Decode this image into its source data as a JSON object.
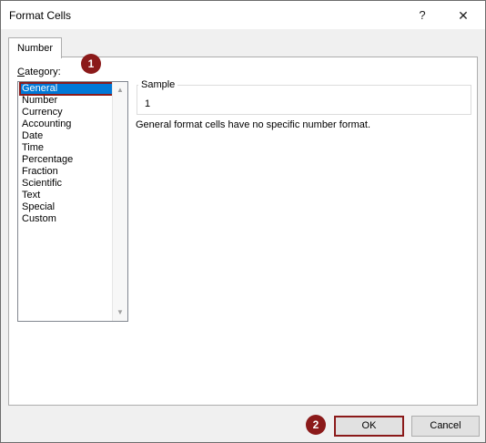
{
  "window": {
    "title": "Format Cells",
    "help_label": "?",
    "close_label": "✕"
  },
  "tabs": [
    {
      "label": "Number",
      "active": true
    }
  ],
  "category": {
    "label_first": "C",
    "label_rest": "ategory:",
    "items": [
      "General",
      "Number",
      "Currency",
      "Accounting",
      "Date",
      "Time",
      "Percentage",
      "Fraction",
      "Scientific",
      "Text",
      "Special",
      "Custom"
    ],
    "selected": "General"
  },
  "sample": {
    "legend": "Sample",
    "value": "1"
  },
  "description": "General format cells have no specific number format.",
  "buttons": {
    "ok": "OK",
    "cancel": "Cancel"
  },
  "markers": [
    "1",
    "2"
  ],
  "scroll_icons": {
    "up": "▲",
    "down": "▼"
  },
  "colors": {
    "selection": "#0078d7",
    "marker": "#8b1a1a",
    "dialog_bg": "#f0f0f0"
  }
}
